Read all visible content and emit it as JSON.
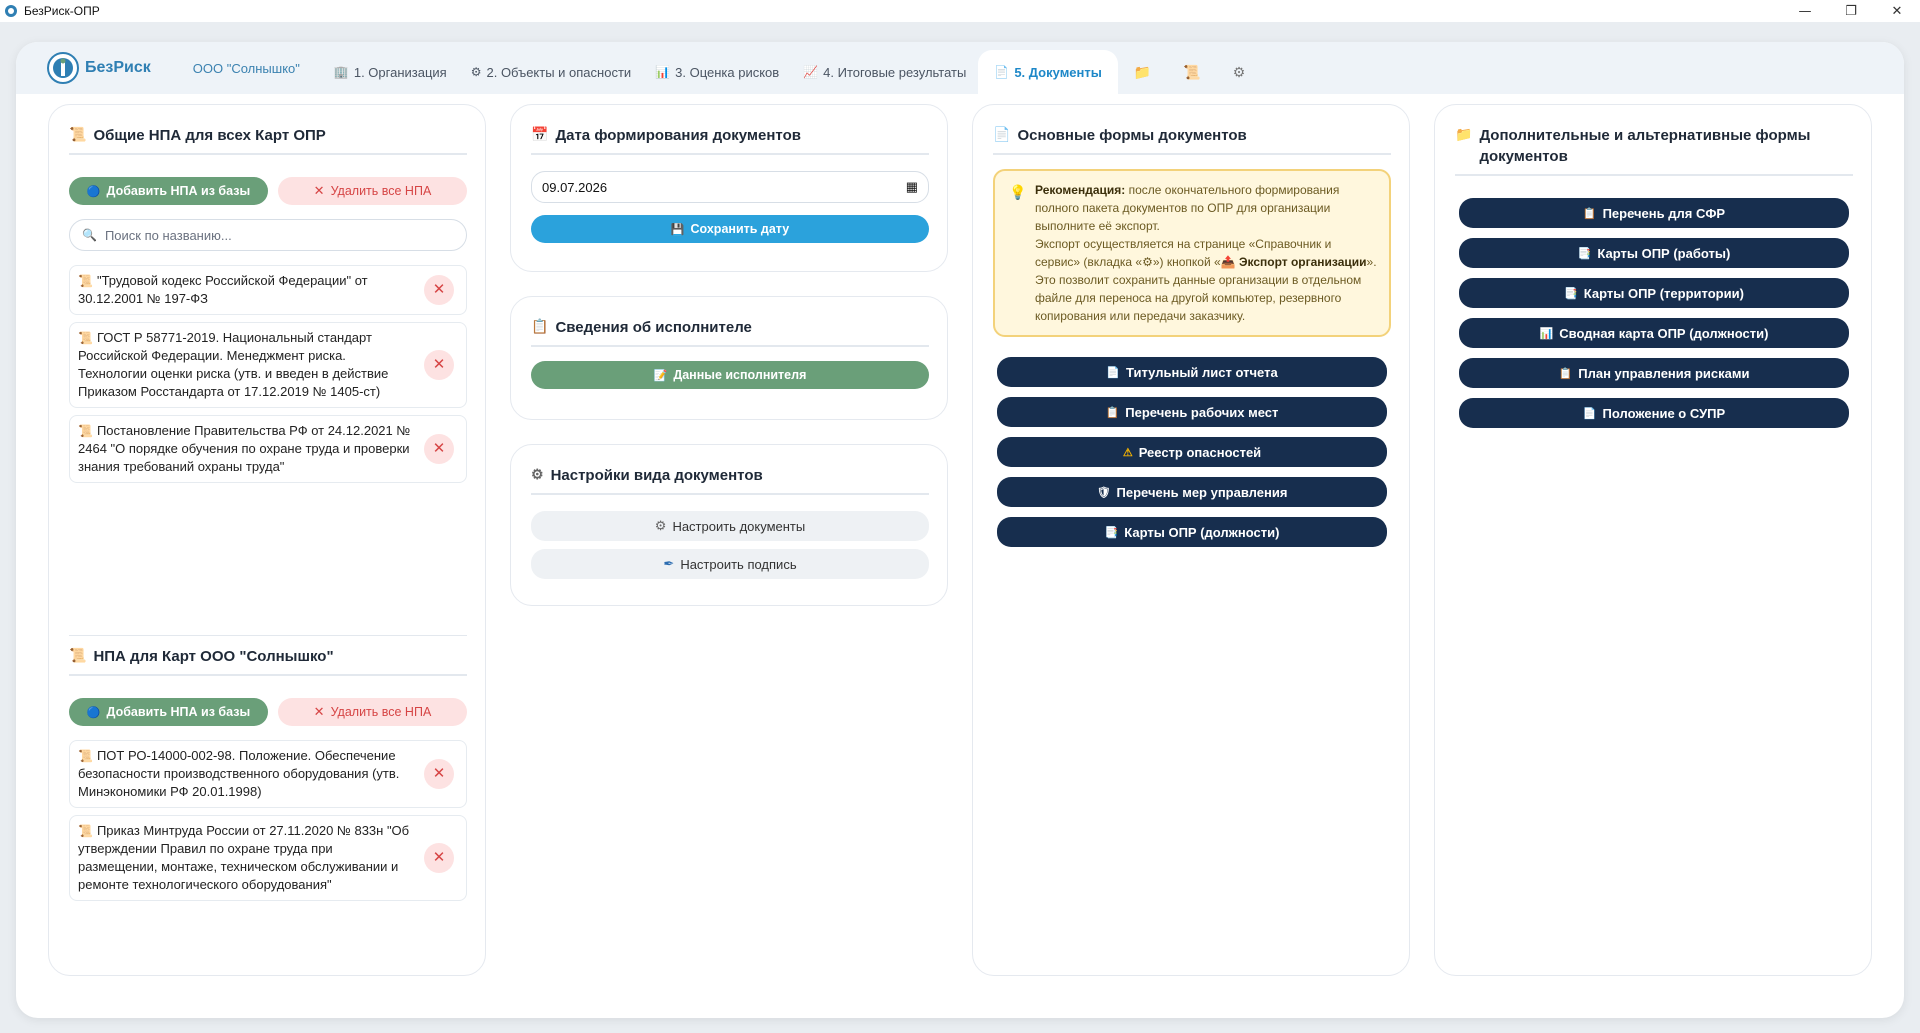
{
  "window": {
    "title": "БезРиск-ОПР"
  },
  "nav": {
    "brand": "БезРиск",
    "org": "ООО \"Солнышко\"",
    "tabs": [
      {
        "label": "1. Организация",
        "icon": "🏢"
      },
      {
        "label": "2. Объекты и опасности",
        "icon": "⚙"
      },
      {
        "label": "3. Оценка рисков",
        "icon": "📊"
      },
      {
        "label": "4. Итоговые результаты",
        "icon": "📈"
      },
      {
        "label": "5. Документы",
        "icon": "📄"
      }
    ],
    "extra_icons": [
      "folder-icon",
      "scroll-icon",
      "gear-icon"
    ]
  },
  "common_npa": {
    "title": "Общие НПА для всех Карт ОПР",
    "add_label": "Добавить НПА из базы",
    "delete_all_label": "Удалить все НПА",
    "search_placeholder": "Поиск по названию...",
    "items": [
      "\"Трудовой кодекс Российской Федерации\" от 30.12.2001 № 197-ФЗ",
      "ГОСТ Р 58771-2019. Национальный стандарт Российской Федерации. Менеджмент риска. Технологии оценки риска (утв. и введен в действие Приказом Росстандарта от 17.12.2019 № 1405-ст)",
      "Постановление Правительства РФ от 24.12.2021 № 2464 \"О порядке обучения по охране труда и проверки знания требований охраны труда\""
    ]
  },
  "org_npa": {
    "title": "НПА для Карт ООО \"Солнышко\"",
    "add_label": "Добавить НПА из базы",
    "delete_all_label": "Удалить все НПА",
    "items": [
      "ПОТ РО-14000-002-98. Положение. Обеспечение безопасности производственного оборудования (утв. Минэкономики РФ 20.01.1998)",
      "Приказ Минтруда России от 27.11.2020 № 833н \"Об утверждении Правил по охране труда при размещении, монтаже, техническом обслуживании и ремонте технологического оборудования\""
    ]
  },
  "date_card": {
    "title": "Дата формирования документов",
    "date_value": "09.07.2026",
    "save_label": "Сохранить дату"
  },
  "executor_card": {
    "title": "Сведения об исполнителе",
    "button_label": "Данные исполнителя"
  },
  "view_settings": {
    "title": "Настройки вида документов",
    "configure_docs_label": "Настроить документы",
    "configure_sign_label": "Настроить подпись"
  },
  "main_forms": {
    "title": "Основные формы документов",
    "recommend_head": "Рекомендация:",
    "recommend_text1": "после окончательного формирования полного пакета документов по ОПР для организации выполните её экспорт.",
    "recommend_text2a": "Экспорт осуществляется на странице «Справочник и сервис» (вкладка «",
    "recommend_text2b": "») кнопкой «",
    "recommend_bold": "Экспорт организации",
    "recommend_text2c": "».",
    "recommend_text3": "Это позволит сохранить данные организации в отдельном файле для переноса на другой компьютер, резервного копирования или передачи заказчику.",
    "buttons": [
      {
        "label": "Титульный лист отчета",
        "icon": "📄"
      },
      {
        "label": "Перечень рабочих мест",
        "icon": "📋"
      },
      {
        "label": "Реестр опасностей",
        "icon": "⚠"
      },
      {
        "label": "Перечень мер управления",
        "icon": "🛡"
      },
      {
        "label": "Карты ОПР (должности)",
        "icon": "📑"
      }
    ]
  },
  "extra_forms": {
    "title": "Дополнительные и альтернативные формы документов",
    "buttons": [
      {
        "label": "Перечень для СФР",
        "icon": "📋"
      },
      {
        "label": "Карты ОПР (работы)",
        "icon": "📑"
      },
      {
        "label": "Карты ОПР (территории)",
        "icon": "📑"
      },
      {
        "label": "Сводная карта ОПР (должности)",
        "icon": "📊"
      },
      {
        "label": "План управления рисками",
        "icon": "📋"
      },
      {
        "label": "Положение о СУПР",
        "icon": "📄"
      }
    ]
  },
  "colors": {
    "accent_blue": "#2ba2dc",
    "green_button": "#6a9f79",
    "navy_button": "#172e4e",
    "danger": "#d64545"
  }
}
